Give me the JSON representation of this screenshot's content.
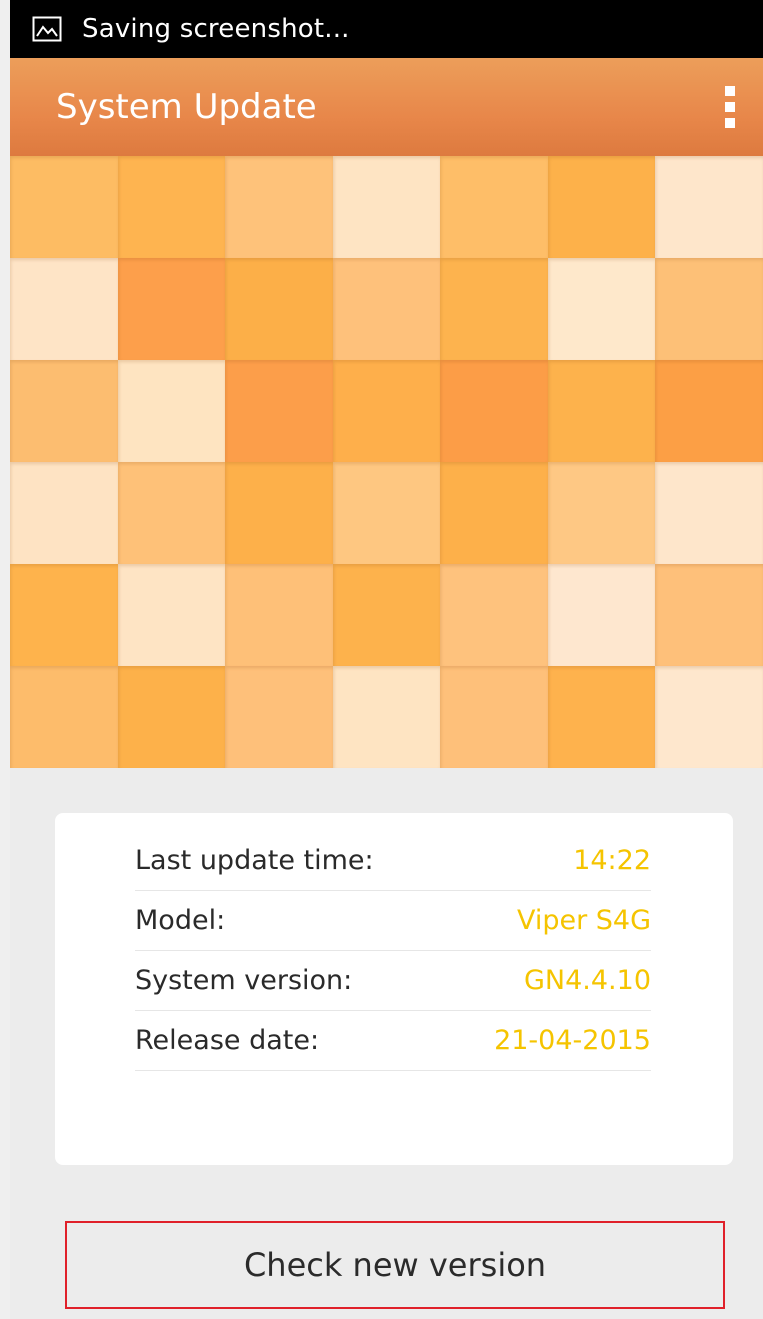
{
  "status_bar": {
    "notification": "Saving screenshot...",
    "icon": "image-icon"
  },
  "action_bar": {
    "title": "System Update",
    "overflow_icon": "overflow-menu-icon"
  },
  "mosaic": {
    "colors": [
      [
        "#fdbc63",
        "#feb450",
        "#fec27a",
        "#fee4c3",
        "#febe68",
        "#fdb14a",
        "#fee6cb"
      ],
      [
        "#fee4c6",
        "#fd9f4b",
        "#fcaf48",
        "#fec17b",
        "#fdb34e",
        "#fee8cb",
        "#fdc077"
      ],
      [
        "#fcbd70",
        "#fee4c1",
        "#fc9e4a",
        "#feaf4b",
        "#fc9d47",
        "#fdb24c",
        "#fc9f45"
      ],
      [
        "#fee3c3",
        "#fec178",
        "#fdb04a",
        "#fec781",
        "#fdb04a",
        "#fec884",
        "#fee6cb"
      ],
      [
        "#feb34c",
        "#fee4c4",
        "#fec078",
        "#fdb24c",
        "#fec27d",
        "#fee7cf",
        "#fec07a"
      ],
      [
        "#fdbc6b",
        "#fdb14a",
        "#fec07a",
        "#fee4c2",
        "#fec07a",
        "#feb24d",
        "#fee7cd"
      ]
    ]
  },
  "info": {
    "rows": [
      {
        "label": "Last update time:",
        "value": "14:22"
      },
      {
        "label": "Model:",
        "value": "Viper S4G"
      },
      {
        "label": "System version:",
        "value": "GN4.4.10"
      },
      {
        "label": "Release date:",
        "value": "21-04-2015"
      }
    ]
  },
  "actions": {
    "check_label": "Check new version"
  },
  "colors": {
    "accent": "#e8874a",
    "value_text": "#f5c400",
    "highlight_border": "#e0202a"
  }
}
